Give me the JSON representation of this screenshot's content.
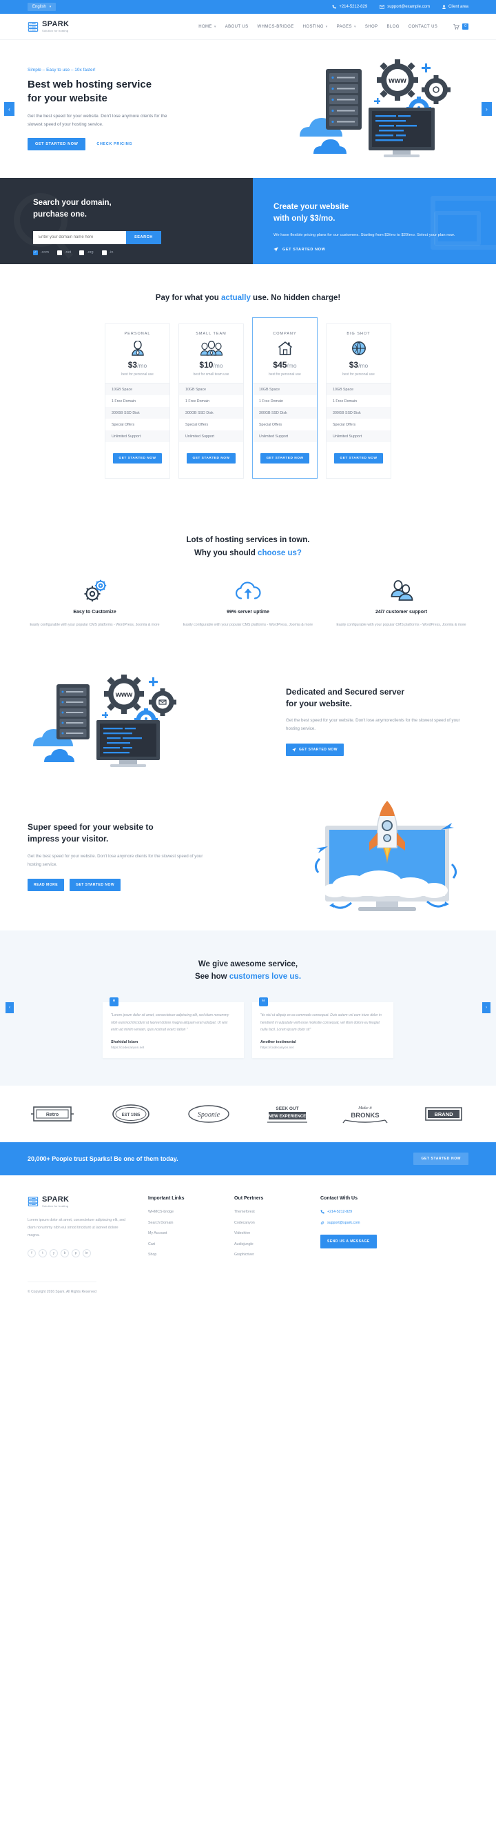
{
  "topbar": {
    "language": "English",
    "phone": "+214-5212-829",
    "email": "support@example.com",
    "client_area": "Client area"
  },
  "brand": {
    "name": "SPARK",
    "tagline": "Solution for hosting"
  },
  "nav": {
    "items": [
      {
        "label": "HOME",
        "has_caret": true
      },
      {
        "label": "ABOUT US",
        "has_caret": false
      },
      {
        "label": "WHMCS-BRIDGE",
        "has_caret": false
      },
      {
        "label": "HOSTING",
        "has_caret": true
      },
      {
        "label": "PAGES",
        "has_caret": true
      },
      {
        "label": "SHOP",
        "has_caret": false
      },
      {
        "label": "BLOG",
        "has_caret": false
      },
      {
        "label": "CONTACT US",
        "has_caret": false
      }
    ],
    "cart_count": "0"
  },
  "hero": {
    "eyebrow": "Simple – Easy to use – 10x faster!",
    "title_line1": "Best web hosting service",
    "title_line2": "for your website",
    "desc": "Get the best speed for your website. Don't lose anymore clients for the slowest speed of your hosting service.",
    "primary_cta": "GET STARTED NOW",
    "secondary_cta": "CHECK PRICING",
    "prev_arrow": "‹",
    "next_arrow": "›"
  },
  "domain": {
    "title_line1": "Search your domain,",
    "title_line2": "purchase one.",
    "input_placeholder": "Enter your domain name here",
    "search_button": "SEARCH",
    "tlds": [
      {
        "label": ".com",
        "checked": true
      },
      {
        "label": ".net",
        "checked": false
      },
      {
        "label": ".org",
        "checked": false
      },
      {
        "label": ".in",
        "checked": false
      }
    ],
    "promo_line1": "Create your website",
    "promo_line2": "with only $3/mo.",
    "promo_desc": "We have flexible pricing plans for our customers. Starting from $3/mo to $20/mo. Select your plan now.",
    "promo_cta": "GET STARTED NOW"
  },
  "pricing": {
    "title_pre": "Pay for what you ",
    "title_hl": "actually",
    "title_post": " use. No hidden charge!",
    "plans": [
      {
        "name": "PERSONAL",
        "icon": "person-icon",
        "price": "$3",
        "per": "/mo",
        "sub": "best for personal use",
        "features": [
          "10GB Space",
          "1 Free Domain",
          "300GB SSD Disk",
          "Special Offers",
          "Unlimited Support"
        ],
        "cta": "GET STARTED NOW",
        "featured": false
      },
      {
        "name": "SMALL TEAM",
        "icon": "group-icon",
        "price": "$10",
        "per": "/mo",
        "sub": "best for small team use",
        "features": [
          "10GB Space",
          "1 Free Domain",
          "300GB SSD Disk",
          "Special Offers",
          "Unlimited Support"
        ],
        "cta": "GET STARTED NOW",
        "featured": false
      },
      {
        "name": "COMPANY",
        "icon": "house-icon",
        "price": "$45",
        "per": "/mo",
        "sub": "best for personal use",
        "features": [
          "10GB Space",
          "1 Free Domain",
          "300GB SSD Disk",
          "Special Offers",
          "Unlimited Support"
        ],
        "cta": "GET STARTED NOW",
        "featured": true
      },
      {
        "name": "BIG SHOT",
        "icon": "globe-icon",
        "price": "$3",
        "per": "/mo",
        "sub": "best for personal use",
        "features": [
          "10GB Space",
          "1 Free Domain",
          "300GB SSD Disk",
          "Special Offers",
          "Unlimited Support"
        ],
        "cta": "GET STARTED NOW",
        "featured": false
      }
    ]
  },
  "features": {
    "title_line1": "Lots of hosting services in town.",
    "title_line2_pre": "Why you should ",
    "title_line2_hl": "choose us?",
    "cards": [
      {
        "icon": "gears-icon",
        "title": "Easy to Customize",
        "desc": "Easily configurable with your popular CMS platforms - WordPress, Joomla & more"
      },
      {
        "icon": "cloud-upload-icon",
        "title": "99% server uptime",
        "desc": "Easily configurable with your popular CMS platforms - WordPress, Joomla & more"
      },
      {
        "icon": "support-people-icon",
        "title": "24/7 customer support",
        "desc": "Easily configurable with your popular CMS platforms - WordPress, Joomla & more"
      }
    ]
  },
  "dedicated": {
    "title_line1": "Dedicated and Secured server",
    "title_line2": "for your website.",
    "desc": "Get the best speed for your website. Don't lose anymoreclients for the slowest speed of your hosting service.",
    "cta": "GET STARTED NOW"
  },
  "speed": {
    "title_line1": "Super speed for your website to",
    "title_line2": "impress your visitor.",
    "desc": "Get the best speed for your website. Don't lose anymore clients for the slowest speed of your hosting service.",
    "cta1": "READ MORE",
    "cta2": "GET STARTED NOW"
  },
  "testimonials": {
    "title_line1": "We give awesome service,",
    "title_line2_pre": "See how ",
    "title_line2_hl": "customers love us.",
    "items": [
      {
        "text": "\"Lorem ipsum dolor sit amet, consectetuer adipiscing elit, sed diam nonummy nibh euismod tincidunt ut laoreet dolore magna aliquam erat volutpat. Ut wisi enim ad minim veniam, quis nostrud exerci tation \"",
        "name": "Shohidul Islam",
        "url": "https://codecanyon.net"
      },
      {
        "text": "\"tis nisl ut aliquip ex ea commodo consequat. Duis autem vel eum iriure dolor in hendrerit in vulputate velit esse molestie consequat, vel illum dolore eu feugiat nulla facil. Lorem ipsum dolor sit\"",
        "name": "Another testimonial",
        "url": "https://codecanyon.net"
      }
    ],
    "prev_arrow": "‹",
    "next_arrow": "›"
  },
  "brands": [
    {
      "name": "retro-label-logo",
      "text": "Retro"
    },
    {
      "name": "vintage-badge-logo",
      "text": "EST 1985"
    },
    {
      "name": "spoonie-script-logo",
      "text": "Spoonie"
    },
    {
      "name": "seek-out-adventure-logo",
      "text": "SEEK OUT NEW EXPERIENCE"
    },
    {
      "name": "bronks-label-logo",
      "text": "Make it BRONKS"
    },
    {
      "name": "brand-badge-logo",
      "text": "BRAND"
    }
  ],
  "ctabar": {
    "text": "20,000+ People trust Sparks! Be one of them today.",
    "button": "GET STARTED NOW"
  },
  "footer": {
    "about": "Lorem ipsum dolor sit amet, consectetuer adipiscing elit, sed diam nonummy nibh eui smod tincidunt ut laoreet dolore magna.",
    "social": [
      "f",
      "t",
      "y",
      "b",
      "p",
      "in"
    ],
    "links_heading": "Important Links",
    "links": [
      "WHMCS-bridge",
      "Search Domain",
      "My Account",
      "Cart",
      "Shop"
    ],
    "partners_heading": "Out Pertners",
    "partners": [
      "Themeforest",
      "Codecanyon",
      "Videohive",
      "Audiojungle",
      "Graphicriver"
    ],
    "contact_heading": "Contact With Us",
    "phone": "+214-5212-829",
    "email": "support@spark.com",
    "message_button": "SEND US A MESSAGE",
    "copyright": "© Copyright 2016 Spark, All Rights Reserved"
  },
  "colors": {
    "accent": "#2f8fef",
    "dark": "#2b323d",
    "text": "#1f2733",
    "muted": "#9aa3b0"
  }
}
